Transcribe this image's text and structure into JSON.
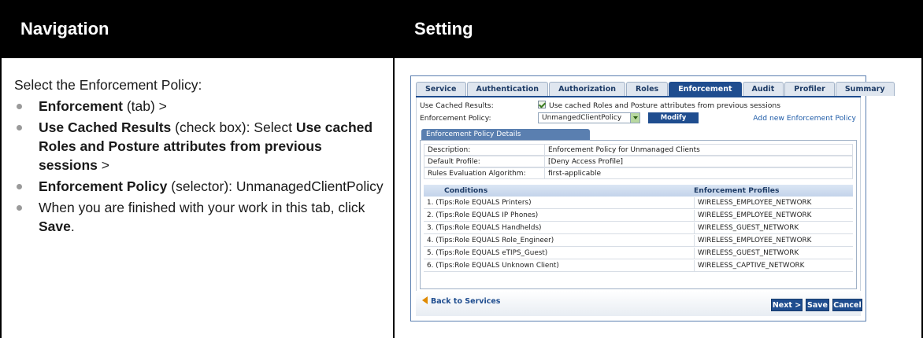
{
  "headers": {
    "navigation": "Navigation",
    "setting": "Setting"
  },
  "navigation": {
    "intro": "Select the Enforcement Policy:",
    "items": [
      {
        "bold": "Enforcement",
        "rest": " (tab) >"
      },
      {
        "bold": "Use Cached Results",
        "rest": " (check box): Select ",
        "bold2": "Use cached Roles and Posture attributes from previous sessions",
        "rest2": " >"
      },
      {
        "bold": "Enforcement Policy",
        "rest": " (selector): UnmanagedClientPolicy"
      },
      {
        "rest": "When you are finished with your work in this tab, click ",
        "bold": "Save",
        "rest2": "."
      }
    ]
  },
  "screenshot": {
    "tabs": [
      {
        "label": "Service",
        "active": false
      },
      {
        "label": "Authentication",
        "active": false
      },
      {
        "label": "Authorization",
        "active": false
      },
      {
        "label": "Roles",
        "active": false
      },
      {
        "label": "Enforcement",
        "active": true
      },
      {
        "label": "Audit",
        "active": false
      },
      {
        "label": "Profiler",
        "active": false
      },
      {
        "label": "Summary",
        "active": false
      }
    ],
    "use_cached_label": "Use Cached Results:",
    "use_cached_text": "Use cached Roles and Posture attributes from previous sessions",
    "policy_label": "Enforcement Policy:",
    "policy_value": "UnmangedClientPolicy",
    "modify_label": "Modify",
    "add_new_label": "Add new Enforcement Policy",
    "details_tab": "Enforcement Policy Details",
    "details": [
      {
        "k": "Description:",
        "v": "Enforcement Policy for Unmanaged Clients"
      },
      {
        "k": "Default Profile:",
        "v": "[Deny Access Profile]"
      },
      {
        "k": "Rules Evaluation Algorithm:",
        "v": "first-applicable"
      }
    ],
    "col_conditions": "Conditions",
    "col_profiles": "Enforcement Profiles",
    "rules": [
      {
        "cond": "1.  (Tips:Role EQUALS Printers)",
        "profile": "WIRELESS_EMPLOYEE_NETWORK"
      },
      {
        "cond": "2.  (Tips:Role EQUALS IP Phones)",
        "profile": "WIRELESS_EMPLOYEE_NETWORK"
      },
      {
        "cond": "3.  (Tips:Role EQUALS Handhelds)",
        "profile": "WIRELESS_GUEST_NETWORK"
      },
      {
        "cond": "4.  (Tips:Role EQUALS Role_Engineer)",
        "profile": "WIRELESS_EMPLOYEE_NETWORK"
      },
      {
        "cond": "5.  (Tips:Role EQUALS eTIPS_Guest)",
        "profile": "WIRELESS_GUEST_NETWORK"
      },
      {
        "cond": "6.  (Tips:Role EQUALS Unknown Client)",
        "profile": "WIRELESS_CAPTIVE_NETWORK"
      }
    ],
    "back_label": "Back to Services",
    "next_label": "Next >",
    "save_label": "Save",
    "cancel_label": "Cancel"
  }
}
